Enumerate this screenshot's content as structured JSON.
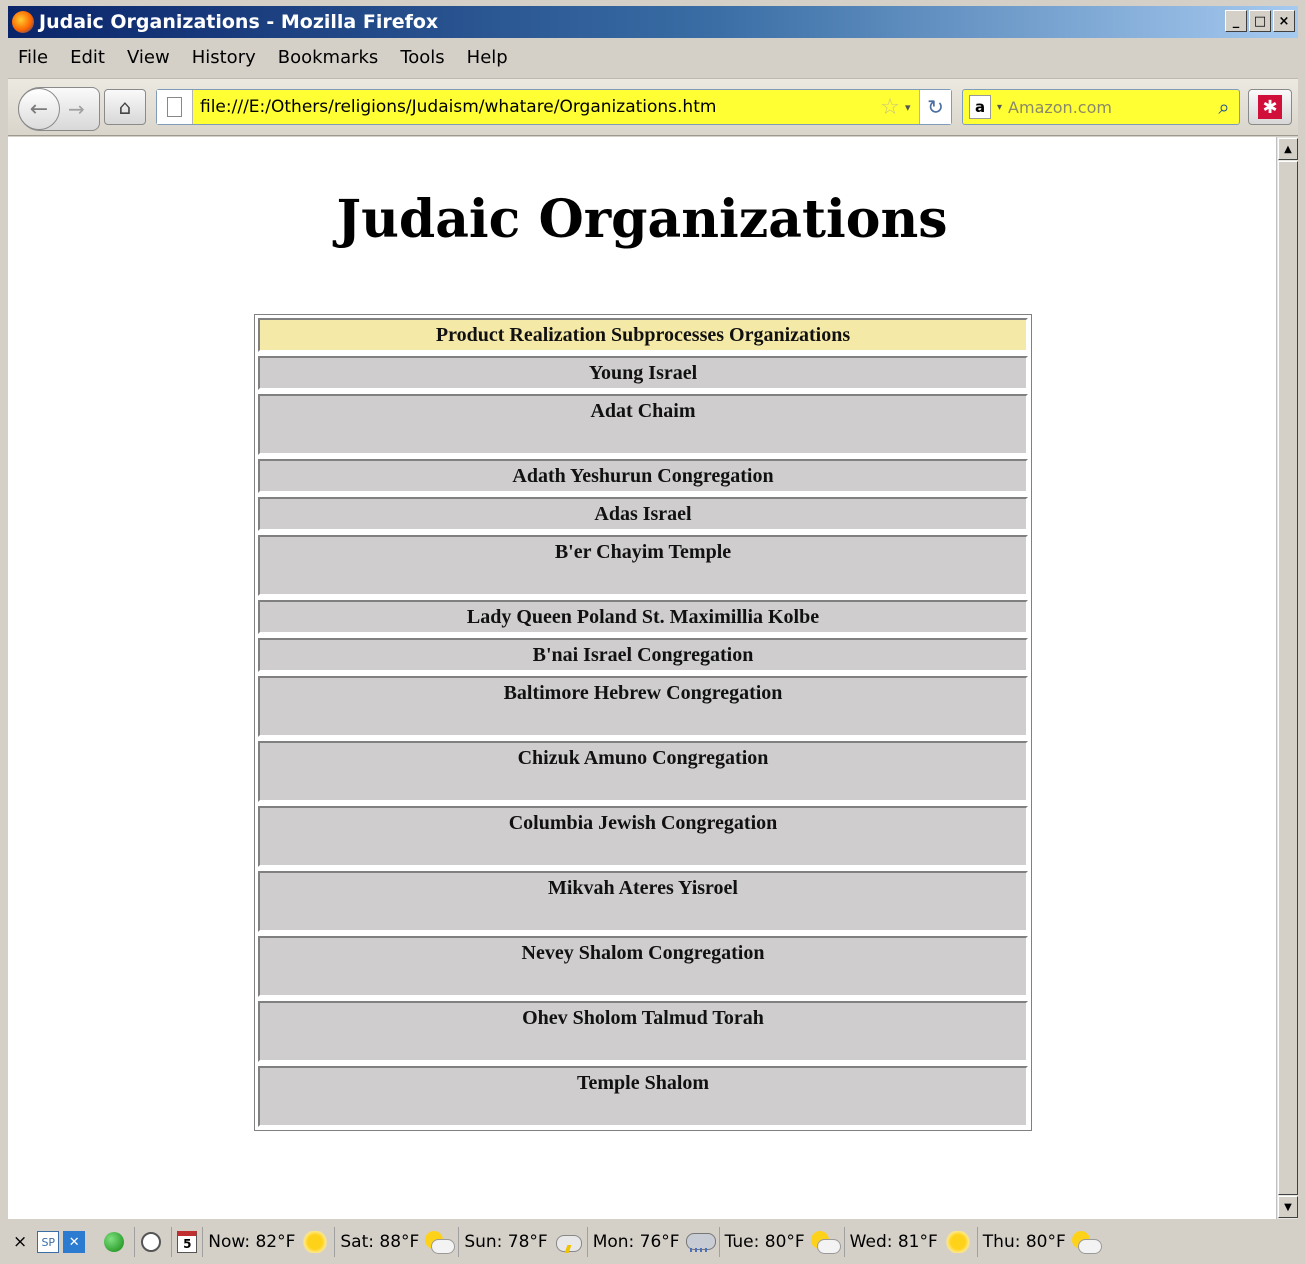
{
  "window": {
    "title": "Judaic Organizations - Mozilla Firefox",
    "controls": [
      "_",
      "□",
      "×"
    ]
  },
  "menu": [
    "File",
    "Edit",
    "View",
    "History",
    "Bookmarks",
    "Tools",
    "Help"
  ],
  "nav": {
    "url": "file:///E:/Others/religions/Judaism/whatare/Organizations.htm",
    "search_placeholder": "Amazon.com",
    "search_engine_icon": "a"
  },
  "page": {
    "heading": "Judaic Organizations",
    "table": {
      "header": "Product Realization Subprocesses Organizations",
      "rows": [
        "Young Israel",
        "Adat Chaim",
        "Adath Yeshurun Congregation",
        "Adas Israel",
        "B'er Chayim Temple",
        "Lady Queen Poland St. Maximillia Kolbe",
        "B'nai Israel Congregation",
        "Baltimore Hebrew Congregation",
        "Chizuk Amuno Congregation",
        "Columbia Jewish Congregation",
        "Mikvah Ateres Yisroel",
        "Nevey Shalom Congregation",
        "Ohev Sholom Talmud Torah",
        "Temple Shalom"
      ]
    }
  },
  "statusbar": {
    "close": "×",
    "sp": "SP",
    "calendar_day": "5",
    "weather": [
      {
        "label": "Now: 82°F",
        "icon": "sunny-icon"
      },
      {
        "label": "Sat: 88°F",
        "icon": "partly-cloudy-icon"
      },
      {
        "label": "Sun: 78°F",
        "icon": "thunderstorm-icon"
      },
      {
        "label": "Mon: 76°F",
        "icon": "rain-icon"
      },
      {
        "label": "Tue: 80°F",
        "icon": "partly-cloudy-icon"
      },
      {
        "label": "Wed: 81°F",
        "icon": "sunny-icon"
      },
      {
        "label": "Thu: 80°F",
        "icon": "partly-cloudy-icon"
      }
    ]
  }
}
